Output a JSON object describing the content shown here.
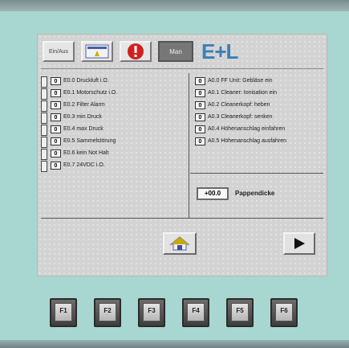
{
  "toolbar": {
    "sinaus_label": "Ein/Aus",
    "man_label": "Man",
    "logo_text": "E+L"
  },
  "inputs": [
    {
      "state": "0",
      "label": "E0.0 Druckluft i.O."
    },
    {
      "state": "0",
      "label": "E0.1 Motorschutz i.O."
    },
    {
      "state": "0",
      "label": "E0.2 Filter Alarm"
    },
    {
      "state": "0",
      "label": "E0.3 min Druck"
    },
    {
      "state": "0",
      "label": "E0.4 max Druck"
    },
    {
      "state": "0",
      "label": "E0.5 Sammelstörung"
    },
    {
      "state": "0",
      "label": "E0.6 kein Not Halt"
    },
    {
      "state": "0",
      "label": "E0.7 24VDC i.O."
    }
  ],
  "outputs": [
    {
      "state": "0",
      "label": "A0.0 FF Unit: Gebläse ein"
    },
    {
      "state": "0",
      "label": "A0.1 Cleaner: Ionisation ein"
    },
    {
      "state": "0",
      "label": "A0.2 Cleanerkopf: heben"
    },
    {
      "state": "0",
      "label": "A0.3 Cleanerkopf: senken"
    },
    {
      "state": "0",
      "label": "A0.4 Höhenanschlag einfahren"
    },
    {
      "state": "0",
      "label": "A0.5 Höhenanschlag ausfahren"
    }
  ],
  "pappendicke": {
    "value": "+00.0",
    "label": "Pappendicke"
  },
  "function_keys": [
    "F1",
    "F2",
    "F3",
    "F4",
    "F5",
    "F6"
  ],
  "colors": {
    "background": "#a8d6d0",
    "panel": "#d3d3d3",
    "logo": "#3b7fb8",
    "alarm": "#d12020"
  },
  "icons": {
    "home": "home-icon",
    "next": "play-arrow-icon",
    "alarm": "alarm-icon"
  }
}
